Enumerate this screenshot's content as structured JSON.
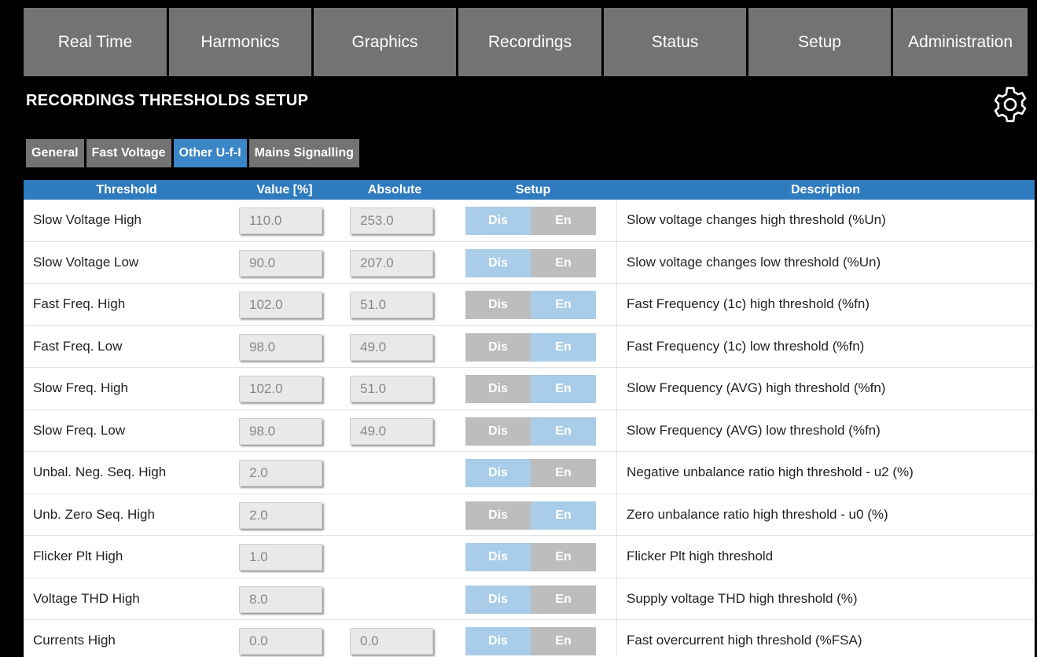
{
  "nav": [
    {
      "label": "Real Time"
    },
    {
      "label": "Harmonics"
    },
    {
      "label": "Graphics"
    },
    {
      "label": "Recordings"
    },
    {
      "label": "Status"
    },
    {
      "label": "Setup"
    },
    {
      "label": "Administration"
    }
  ],
  "page_title": "RECORDINGS THRESHOLDS SETUP",
  "subtabs": [
    {
      "label": "General",
      "active": false
    },
    {
      "label": "Fast Voltage",
      "active": false
    },
    {
      "label": "Other U-f-I",
      "active": true
    },
    {
      "label": "Mains Signalling",
      "active": false
    }
  ],
  "table": {
    "headers": {
      "threshold": "Threshold",
      "value": "Value [%]",
      "absolute": "Absolute",
      "setup": "Setup",
      "description": "Description"
    },
    "dis_label": "Dis",
    "en_label": "En",
    "rows": [
      {
        "name": "Slow Voltage High",
        "value": "110.0",
        "absolute": "253.0",
        "enabled": false,
        "description": "Slow voltage changes high threshold (%Un)"
      },
      {
        "name": "Slow Voltage Low",
        "value": "90.0",
        "absolute": "207.0",
        "enabled": false,
        "description": "Slow voltage changes low threshold (%Un)"
      },
      {
        "name": "Fast Freq. High",
        "value": "102.0",
        "absolute": "51.0",
        "enabled": true,
        "description": "Fast Frequency (1c) high threshold (%fn)"
      },
      {
        "name": "Fast Freq. Low",
        "value": "98.0",
        "absolute": "49.0",
        "enabled": true,
        "description": "Fast Frequency (1c) low threshold (%fn)"
      },
      {
        "name": "Slow Freq. High",
        "value": "102.0",
        "absolute": "51.0",
        "enabled": true,
        "description": "Slow Frequency (AVG) high threshold (%fn)"
      },
      {
        "name": "Slow Freq. Low",
        "value": "98.0",
        "absolute": "49.0",
        "enabled": true,
        "description": "Slow Frequency (AVG) low threshold (%fn)"
      },
      {
        "name": "Unbal. Neg. Seq. High",
        "value": "2.0",
        "absolute": null,
        "enabled": false,
        "description": "Negative unbalance ratio high threshold - u2 (%)"
      },
      {
        "name": "Unb. Zero Seq. High",
        "value": "2.0",
        "absolute": null,
        "enabled": true,
        "description": "Zero unbalance ratio high threshold - u0 (%)"
      },
      {
        "name": "Flicker Plt High",
        "value": "1.0",
        "absolute": null,
        "enabled": false,
        "description": "Flicker Plt high threshold"
      },
      {
        "name": "Voltage THD High",
        "value": "8.0",
        "absolute": null,
        "enabled": false,
        "description": "Supply voltage THD high threshold (%)"
      },
      {
        "name": "Currents High",
        "value": "0.0",
        "absolute": "0.0",
        "enabled": false,
        "description": "Fast overcurrent high threshold (%FSA)"
      }
    ]
  },
  "colors": {
    "nav_bg": "#737373",
    "accent": "#3b86c6",
    "header_bg": "#2f7bbf",
    "toggle_on": "#a9cde8",
    "toggle_off": "#bdbdbd"
  },
  "icons": {
    "settings": "gear-icon"
  }
}
